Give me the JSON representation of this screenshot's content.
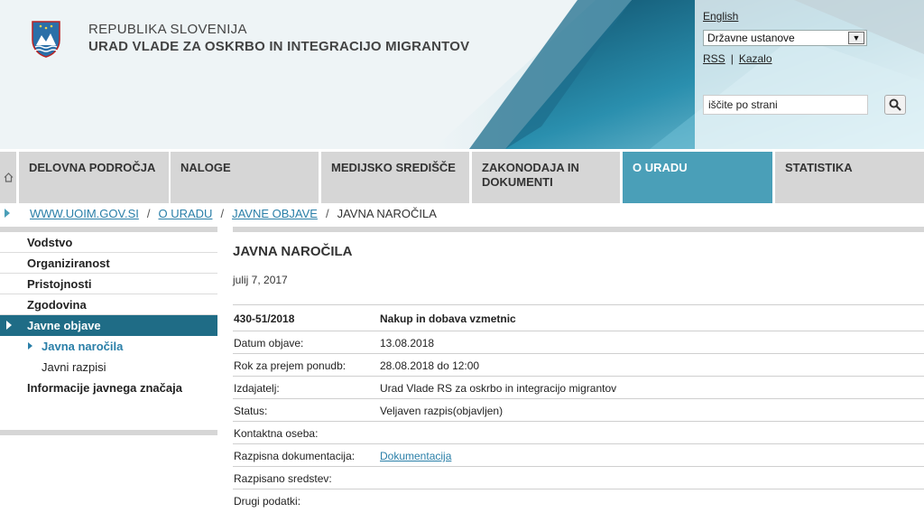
{
  "header": {
    "government": "REPUBLIKA SLOVENIJA",
    "office": "URAD VLADE ZA OSKRBO IN INTEGRACIJO MIGRANTOV",
    "language_link": "English",
    "institutions_select": "Državne ustanove",
    "rss_link": "RSS",
    "index_link": "Kazalo",
    "search_value": "iščite po strani",
    "colors": {
      "accent": "#4a9fb8",
      "dark_accent": "#1f6c86"
    }
  },
  "nav": {
    "home_icon": "home-icon",
    "tabs": [
      {
        "label": "DELOVNA PODROČJA"
      },
      {
        "label": "NALOGE"
      },
      {
        "label": "MEDIJSKO SREDIŠČE"
      },
      {
        "label": "ZAKONODAJA IN DOKUMENTI"
      },
      {
        "label": "O URADU"
      },
      {
        "label": "STATISTIKA"
      }
    ]
  },
  "breadcrumb": {
    "items": [
      "WWW.UOIM.GOV.SI",
      "O URADU",
      "JAVNE OBJAVE"
    ],
    "current": "JAVNA NAROČILA",
    "separator": "/"
  },
  "sidebar": {
    "items": [
      {
        "label": "Vodstvo"
      },
      {
        "label": "Organiziranost"
      },
      {
        "label": "Pristojnosti"
      },
      {
        "label": "Zgodovina"
      },
      {
        "label": "Javne objave"
      },
      {
        "label": "Javna naročila"
      },
      {
        "label": "Javni razpisi"
      },
      {
        "label": "Informacije javnega značaja"
      }
    ]
  },
  "main": {
    "title": "JAVNA NAROČILA",
    "date": "julij 7, 2017",
    "record": {
      "number": "430-51/2018",
      "subject": "Nakup in dobava vzmetnic"
    },
    "rows": [
      {
        "key": "Datum objave:",
        "value": "13.08.2018"
      },
      {
        "key": "Rok za prejem ponudb:",
        "value": "28.08.2018 do 12:00"
      },
      {
        "key": "Izdajatelj:",
        "value": "Urad Vlade RS za oskrbo in integracijo migrantov"
      },
      {
        "key": "Status:",
        "value": "Veljaven razpis(objavljen)"
      },
      {
        "key": "Kontaktna oseba:",
        "value": ""
      },
      {
        "key": "Razpisna dokumentacija:",
        "value": "Dokumentacija"
      },
      {
        "key": "Razpisano sredstev:",
        "value": ""
      },
      {
        "key": "Drugi podatki:",
        "value": ""
      }
    ]
  }
}
